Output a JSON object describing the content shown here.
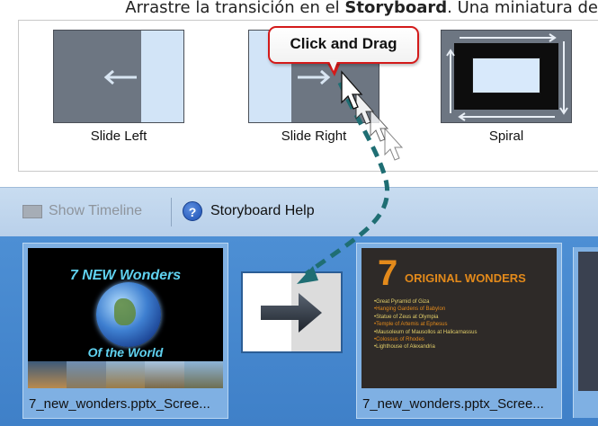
{
  "caption": {
    "before": "Arrastre la transición en el ",
    "bold": "Storyboard",
    "after": ". Una miniatura de"
  },
  "gallery": {
    "transitions": [
      {
        "label": "Slide Left"
      },
      {
        "label": "Slide Right"
      },
      {
        "label": "Spiral"
      }
    ]
  },
  "callout": {
    "text": "Click and Drag"
  },
  "toolbar": {
    "show_timeline": "Show Timeline",
    "storyboard_help": "Storyboard Help"
  },
  "storyboard": {
    "slide1": {
      "filename": "7_new_wonders.pptx_Scree...",
      "title_line1": "7 NEW Wonders",
      "title_line2": "Of the World"
    },
    "slide2": {
      "filename": "7_new_wonders.pptx_Scree...",
      "big_number": "7",
      "title": "ORIGINAL WONDERS",
      "items": [
        "•Great Pyramid of Giza",
        "•Hanging Gardens of Babylon",
        "•Statue of Zeus at Olympia",
        "•Temple of Artemis at Ephesus",
        "•Mausoleum of Mausollos at Halicarnassus",
        "•Colossus of Rhodes",
        "•Lighthouse of Alexandria"
      ]
    }
  },
  "colors": {
    "callout_border": "#d31a1a",
    "storyboard_bg": "#4a8bd0",
    "drag_path": "#1f6e73",
    "slide2_accent": "#e38a1b"
  }
}
